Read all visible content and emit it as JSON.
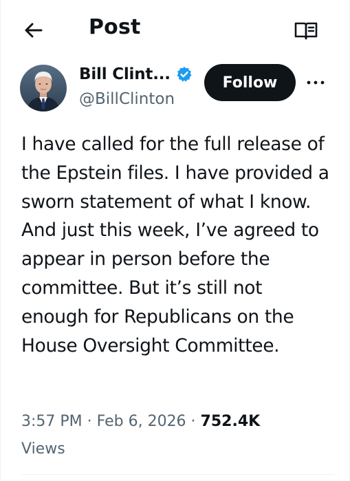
{
  "header": {
    "title": "Post",
    "back_icon": "arrow-left-icon",
    "reader_icon": "book-open-icon"
  },
  "author": {
    "name": "Bill Clint...",
    "handle": "@BillClinton",
    "verified": true,
    "verified_color": "#1d9bf0"
  },
  "actions": {
    "follow_label": "Follow",
    "more_icon": "more-dots-icon"
  },
  "post": {
    "text": "I have called for the full release of the Epstein files. I have provided a sworn statement of what I know. And just this week, I’ve agreed to appear in person before the committee. But it’s still not enough for Republicans on the House Oversight Committee.",
    "time": "3:57 PM",
    "separator": " · ",
    "date": "Feb 6, 2026",
    "views_count": "752.4K",
    "views_label": "Views"
  },
  "colors": {
    "text": "#0f1419",
    "secondary": "#536471",
    "button": "#0f1419"
  }
}
